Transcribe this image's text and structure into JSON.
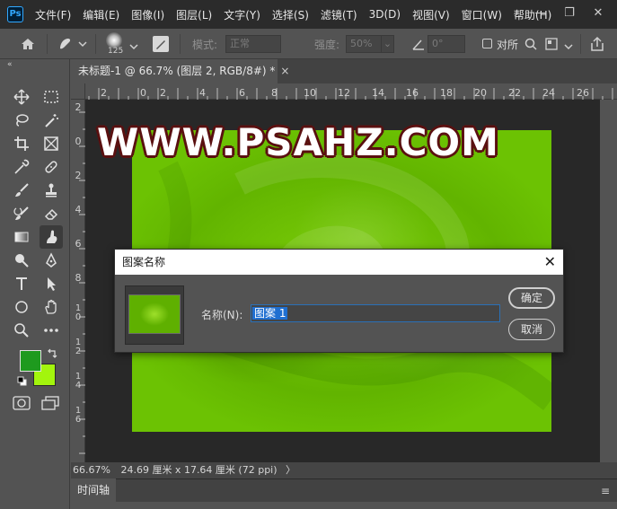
{
  "app": {
    "logo": "Ps",
    "menu": [
      "文件(F)",
      "编辑(E)",
      "图像(I)",
      "图层(L)",
      "文字(Y)",
      "选择(S)",
      "滤镜(T)",
      "3D(D)",
      "视图(V)",
      "窗口(W)",
      "帮助(H)"
    ],
    "window_controls": {
      "minimize": "—",
      "restore": "❐",
      "close": "✕"
    }
  },
  "options_bar": {
    "brush_size": "125",
    "mode_label": "模式:",
    "mode_value": "正常",
    "strength_label": "强度:",
    "strength_value": "50%",
    "angle_value": "0°",
    "align_label": "对所"
  },
  "document": {
    "tab_title": "未标题-1 @ 66.7% (图层 2, RGB/8#) *",
    "tab_close": "×",
    "ruler_top": [
      "2",
      "0",
      "2",
      "4",
      "6",
      "8",
      "10",
      "12",
      "14",
      "16",
      "18",
      "20",
      "22",
      "24",
      "26"
    ],
    "ruler_left": [
      "2",
      "0",
      "2",
      "4",
      "6",
      "8",
      "1 0",
      "1 2",
      "1 4",
      "1 6"
    ],
    "watermark": "WWW.PSAHZ.COM"
  },
  "dialog": {
    "title": "图案名称",
    "close": "✕",
    "name_label": "名称(N):",
    "name_value": "图案 1",
    "ok_label": "确定",
    "cancel_label": "取消"
  },
  "status": {
    "zoom": "66.67%",
    "doc_size": "24.69 厘米 x 17.64 厘米 (72 ppi)",
    "arrow": "〉"
  },
  "timeline": {
    "tab_label": "时间轴",
    "menu_icon": "≡"
  },
  "toolbar": {
    "collapse": "«"
  },
  "colors": {
    "foreground": "#1e9a1e",
    "background": "#a3f50d"
  }
}
